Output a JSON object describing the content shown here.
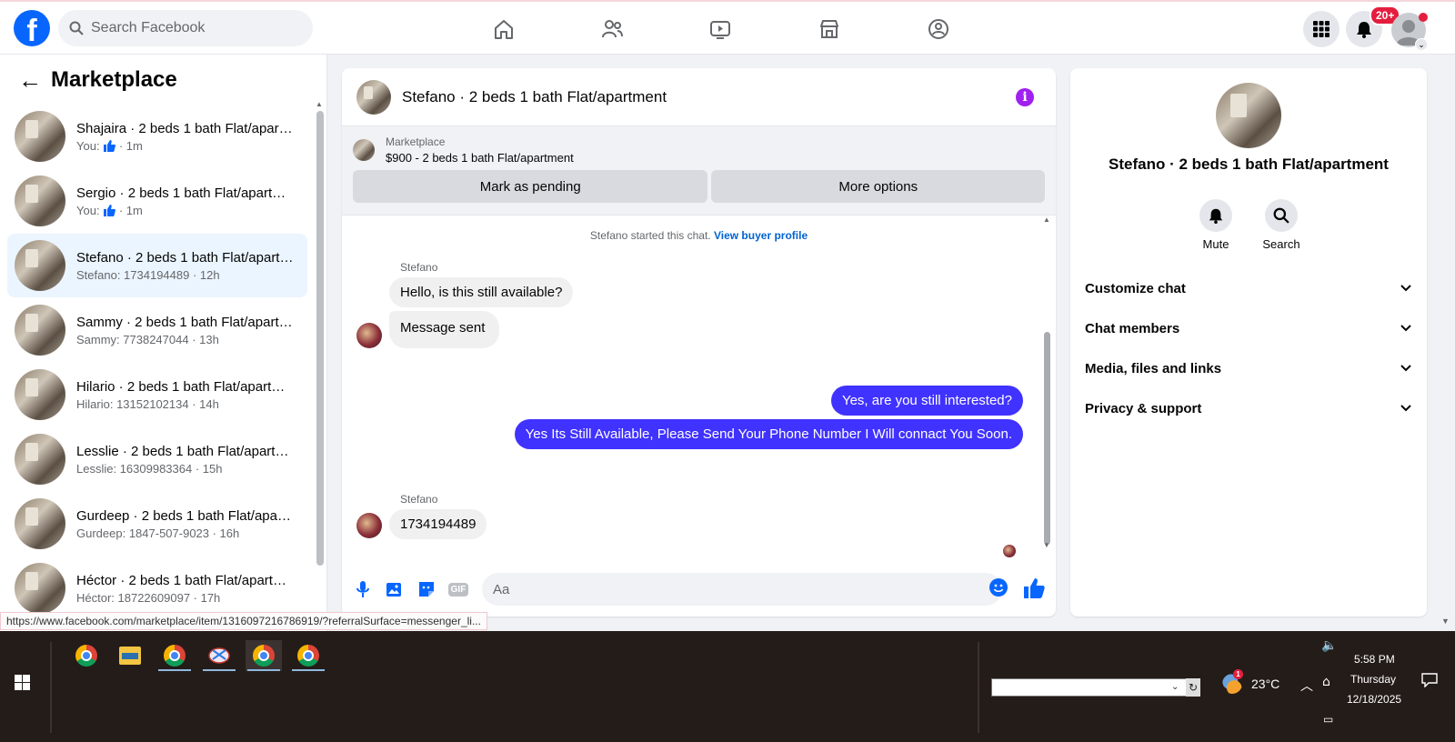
{
  "topbar": {
    "logo_letter": "f",
    "search_placeholder": "Search Facebook",
    "notification_badge": "20+"
  },
  "sidebar": {
    "title": "Marketplace",
    "conversations": [
      {
        "name": "Shajaira · 2 beds 1 bath Flat/apartment",
        "prefix": "You:",
        "has_like": true,
        "time": "· 1m",
        "preview": ""
      },
      {
        "name": "Sergio · 2 beds 1 bath Flat/apartment",
        "prefix": "You:",
        "has_like": true,
        "time": "· 1m",
        "preview": ""
      },
      {
        "name": "Stefano · 2 beds 1 bath Flat/apartment",
        "prefix": "",
        "has_like": false,
        "time": "",
        "preview": "Stefano: 1734194489 · 12h",
        "active": true
      },
      {
        "name": "Sammy · 2 beds 1 bath Flat/apartment",
        "prefix": "",
        "has_like": false,
        "time": "",
        "preview": "Sammy: 7738247044 · 13h"
      },
      {
        "name": "Hilario · 2 beds 1 bath Flat/apartment",
        "prefix": "",
        "has_like": false,
        "time": "",
        "preview": "Hilario: 13152102134 · 14h"
      },
      {
        "name": "Lesslie · 2 beds 1 bath Flat/apartment",
        "prefix": "",
        "has_like": false,
        "time": "",
        "preview": "Lesslie: 16309983364 · 15h"
      },
      {
        "name": "Gurdeep · 2 beds 1 bath Flat/apartment",
        "prefix": "",
        "has_like": false,
        "time": "",
        "preview": "Gurdeep: 1847-507-9023 · 16h"
      },
      {
        "name": "Héctor · 2 beds 1 bath Flat/apartment",
        "prefix": "",
        "has_like": false,
        "time": "",
        "preview": "Héctor: 18722609097 · 17h"
      }
    ]
  },
  "chat": {
    "title": "Stefano · 2 beds 1 bath Flat/apartment",
    "listing_source": "Marketplace",
    "listing_price": "$900 - 2 beds 1 bath Flat/apartment",
    "btn_pending": "Mark as pending",
    "btn_more": "More options",
    "system_note": "Stefano started this chat.",
    "system_link": "View buyer profile",
    "sender1": "Stefano",
    "msg1": "Hello, is this still available?",
    "msg2": "Message sent",
    "msg3": "Yes, are you still interested?",
    "msg4": "Yes Its Still Available, Please Send Your Phone Number I Will connact You Soon.",
    "sender2": "Stefano",
    "msg5": "1734194489",
    "composer_placeholder": "Aa",
    "gif_label": "GIF"
  },
  "info_panel": {
    "name": "Stefano · 2 beds 1 bath Flat/apartment",
    "mute_label": "Mute",
    "search_label": "Search",
    "sections": [
      "Customize chat",
      "Chat members",
      "Media, files and links",
      "Privacy & support"
    ]
  },
  "status_url": "https://www.facebook.com/marketplace/item/1316097216786919/?referralSurface=messenger_li...",
  "taskbar": {
    "temperature": "23°C",
    "time": "5:58 PM",
    "day": "Thursday",
    "date": "12/18/2025",
    "weather_badge": "1"
  },
  "colors": {
    "brand": "#0866ff",
    "outgoing_bubble": "#4032ff",
    "active_item": "#ebf5ff",
    "notification": "#e41e3f"
  }
}
